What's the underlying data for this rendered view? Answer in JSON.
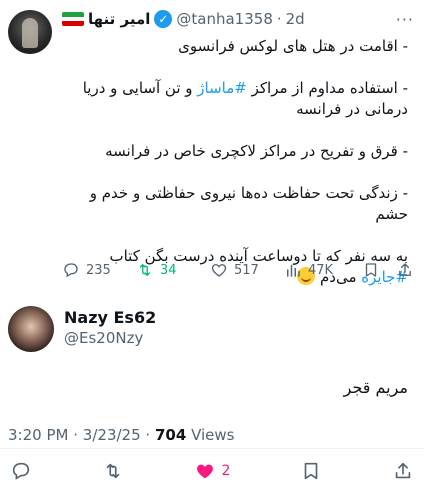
{
  "quoted": {
    "display_name": "امیر تنها",
    "handle": "@tanha1358",
    "separator": "·",
    "time": "2d",
    "more_label": "···",
    "lines": [
      "- اقامت در هتل های لوکس فرانسوی",
      "",
      "- استفاده مداوم از مراکز",
      "",
      "- قرق و تفریح در مراکز لاکچری خاص در فرانسه",
      "",
      "- زندگی تحت حفاظت ده‌ها نیروی حفاظتی و خدم و حشم",
      ""
    ],
    "line2_hashtag": "#ماساژ",
    "line2_rest": " و تن آسایی و دریا درمانی در فرانسه",
    "last_line_pre": "به سه نفر که تا دوساعت آینده درست بگن کتاب ",
    "last_line_hashtag": "#جایزه",
    "last_line_post": " می‌دم",
    "emoji": "grinning-face",
    "stats": {
      "replies": "235",
      "retweets": "34",
      "likes": "517",
      "views": "47K"
    }
  },
  "reply": {
    "display_name": "Nazy Es62",
    "handle": "@Es20Nzy",
    "text": "مریم قجر"
  },
  "meta": {
    "time": "3:20 PM",
    "sep1": "·",
    "date": "3/23/25",
    "sep2": "·",
    "views": "704",
    "views_label": "Views"
  },
  "actions": {
    "likes": "2"
  },
  "colors": {
    "accent": "#1d9bf0",
    "retweet": "#00ba7c",
    "like": "#f91880",
    "muted": "#536471"
  }
}
